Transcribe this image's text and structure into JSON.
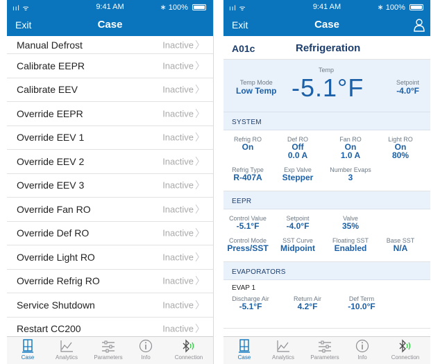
{
  "status_bar": {
    "signal": "ııl ᯤ",
    "time": "9:41 AM",
    "battery": "100%"
  },
  "left": {
    "nav": {
      "exit": "Exit",
      "title": "Case"
    },
    "items": [
      {
        "label": "Manual Defrost",
        "status": "Inactive"
      },
      {
        "label": "Calibrate EEPR",
        "status": "Inactive"
      },
      {
        "label": "Calibrate EEV",
        "status": "Inactive"
      },
      {
        "label": "Override EEPR",
        "status": "Inactive"
      },
      {
        "label": "Override EEV 1",
        "status": "Inactive"
      },
      {
        "label": "Override EEV 2",
        "status": "Inactive"
      },
      {
        "label": "Override EEV 3",
        "status": "Inactive"
      },
      {
        "label": "Override Fan RO",
        "status": "Inactive"
      },
      {
        "label": "Override Def RO",
        "status": "Inactive"
      },
      {
        "label": "Override Light RO",
        "status": "Inactive"
      },
      {
        "label": "Override Refrig RO",
        "status": "Inactive"
      },
      {
        "label": "Service Shutdown",
        "status": "Inactive"
      },
      {
        "label": "Restart CC200",
        "status": "Inactive"
      }
    ]
  },
  "right": {
    "nav": {
      "exit": "Exit",
      "title": "Case"
    },
    "case_id": "A01c",
    "case_type": "Refrigeration",
    "temp_panel": {
      "temp_mode_label": "Temp Mode",
      "temp_mode": "Low Temp",
      "temp_label": "Temp",
      "temp": "-5.1°F",
      "setpoint_label": "Setpoint",
      "setpoint": "-4.0°F"
    },
    "system": {
      "header": "SYSTEM",
      "refrig_ro_label": "Refrig RO",
      "refrig_ro": "On",
      "def_ro_label": "Def RO",
      "def_ro": "Off",
      "def_ro_amps": "0.0 A",
      "fan_ro_label": "Fan RO",
      "fan_ro": "On",
      "fan_ro_amps": "1.0 A",
      "light_ro_label": "Light RO",
      "light_ro": "On",
      "light_ro_pct": "80%",
      "refrig_type_label": "Refrig Type",
      "refrig_type": "R-407A",
      "exp_valve_label": "Exp Valve",
      "exp_valve": "Stepper",
      "num_evaps_label": "Number Evaps",
      "num_evaps": "3"
    },
    "eepr": {
      "header": "EEPR",
      "control_value_label": "Control Value",
      "control_value": "-5.1°F",
      "setpoint_label": "Setpoint",
      "setpoint": "-4.0°F",
      "valve_label": "Valve",
      "valve": "35%",
      "control_mode_label": "Control Mode",
      "control_mode": "Press/SST",
      "sst_curve_label": "SST Curve",
      "sst_curve": "Midpoint",
      "floating_sst_label": "Floating SST",
      "floating_sst": "Enabled",
      "base_sst_label": "Base SST",
      "base_sst": "N/A"
    },
    "evaporators": {
      "header": "EVAPORATORS",
      "evap_name": "EVAP 1",
      "discharge_air_label": "Discharge Air",
      "discharge_air": "-5.1°F",
      "return_air_label": "Return Air",
      "return_air": "4.2°F",
      "def_term_label": "Def Term",
      "def_term": "-10.0°F"
    }
  },
  "tabs": [
    {
      "label": "Case",
      "icon": "case-icon"
    },
    {
      "label": "Analytics",
      "icon": "analytics-icon"
    },
    {
      "label": "Parameters",
      "icon": "parameters-icon"
    },
    {
      "label": "Info",
      "icon": "info-icon"
    },
    {
      "label": "Connection",
      "icon": "bluetooth-icon"
    }
  ],
  "colors": {
    "brand": "#0a74bd",
    "value": "#1b5fa6",
    "panel": "#e9f1fa",
    "inactive": "#a9a9a9"
  }
}
